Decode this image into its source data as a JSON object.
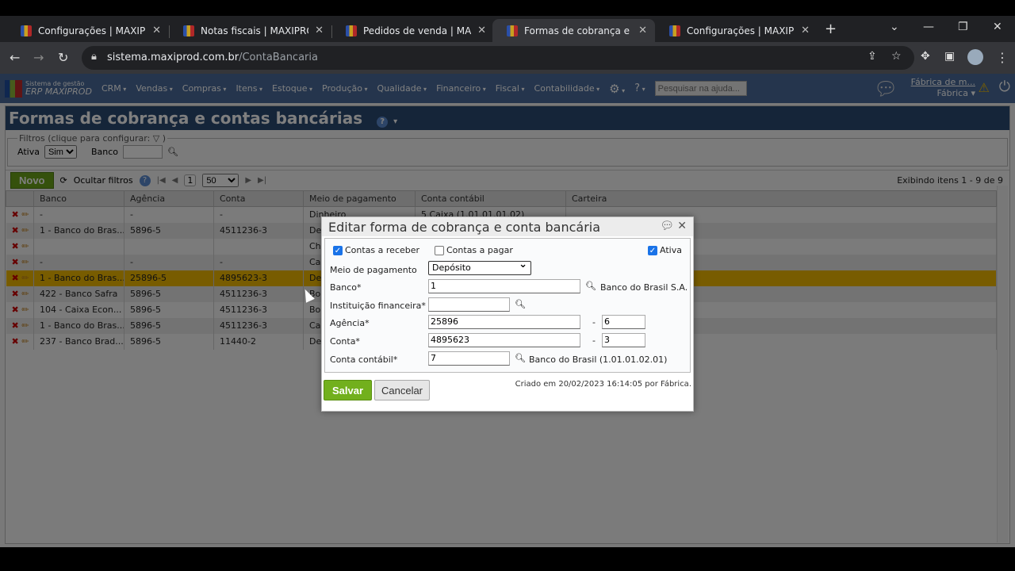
{
  "browser": {
    "tabs": [
      "Configurações | MAXIPROD",
      "Notas fiscais | MAXIPROD",
      "Pedidos de venda | MAXIPROD",
      "Formas de cobrança e contas bancárias",
      "Configurações | MAXIPROD"
    ],
    "active_tab": 3,
    "url_host": "sistema.maxiprod.com.br",
    "url_path": "/ContaBancaria"
  },
  "app": {
    "logo_line1": "Sistema de gestão",
    "logo_line2": "ERP MAXIPROD",
    "menu": [
      "CRM",
      "Vendas",
      "Compras",
      "Itens",
      "Estoque",
      "Produção",
      "Qualidade",
      "Financeiro",
      "Fiscal",
      "Contabilidade"
    ],
    "help_search_placeholder": "Pesquisar na ajuda...",
    "user_company": "Fábrica de m...",
    "user_name": "Fábrica"
  },
  "page": {
    "title": "Formas de cobrança e contas bancárias",
    "filters": {
      "legend": "Filtros (clique para configurar:",
      "legend_end": ")",
      "ativa_label": "Ativa",
      "ativa_value": "Sim",
      "banco_label": "Banco"
    },
    "toolbar": {
      "novo": "Novo",
      "hide_filters": "Ocultar filtros",
      "page": "1",
      "page_size": "50",
      "showing": "Exibindo itens 1 - 9 de 9"
    },
    "columns": [
      "Banco",
      "Agência",
      "Conta",
      "Meio de pagamento",
      "Conta contábil",
      "Carteira"
    ],
    "rows": [
      [
        "-",
        "-",
        "-",
        "Dinheiro",
        "5 Caixa (1.01.01.01.02)",
        ""
      ],
      [
        "1 - Banco do Bras...",
        "5896-5",
        "4511236-3",
        "Depósito",
        "",
        ""
      ],
      [
        "",
        "",
        "",
        "Cheque",
        "",
        ""
      ],
      [
        "-",
        "-",
        "-",
        "Cartão",
        "",
        ""
      ],
      [
        "1 - Banco do Bras...",
        "25896-5",
        "4895623-3",
        "Depósito",
        "",
        ""
      ],
      [
        "422 - Banco Safra",
        "5896-5",
        "4511236-3",
        "Boleto",
        "",
        ""
      ],
      [
        "104 - Caixa Econ...",
        "5896-5",
        "4511236-3",
        "Boleto",
        "",
        ""
      ],
      [
        "1 - Banco do Bras...",
        "5896-5",
        "4511236-3",
        "Cartão",
        "",
        ""
      ],
      [
        "237 - Banco Brad...",
        "5896-5",
        "11440-2",
        "Depósito",
        "",
        ""
      ]
    ],
    "selected_row": 4
  },
  "dialog": {
    "title": "Editar forma de cobrança e conta bancária",
    "contas_receber": "Contas a receber",
    "contas_receber_checked": true,
    "contas_pagar": "Contas a pagar",
    "contas_pagar_checked": false,
    "ativa": "Ativa",
    "ativa_checked": true,
    "meio_label": "Meio de pagamento",
    "meio_value": "Depósito",
    "banco_label": "Banco*",
    "banco_value": "1",
    "banco_name": "Banco do Brasil S.A.",
    "inst_label": "Instituição financeira*",
    "inst_value": "",
    "agencia_label": "Agência*",
    "agencia_value": "25896",
    "agencia_dv": "6",
    "conta_label": "Conta*",
    "conta_value": "4895623",
    "conta_dv": "3",
    "contabil_label": "Conta contábil*",
    "contabil_value": "7",
    "contabil_name": "Banco do Brasil (1.01.01.02.01)",
    "dash": "-",
    "save": "Salvar",
    "cancel": "Cancelar",
    "created": "Criado em 20/02/2023 16:14:05 por Fábrica."
  }
}
